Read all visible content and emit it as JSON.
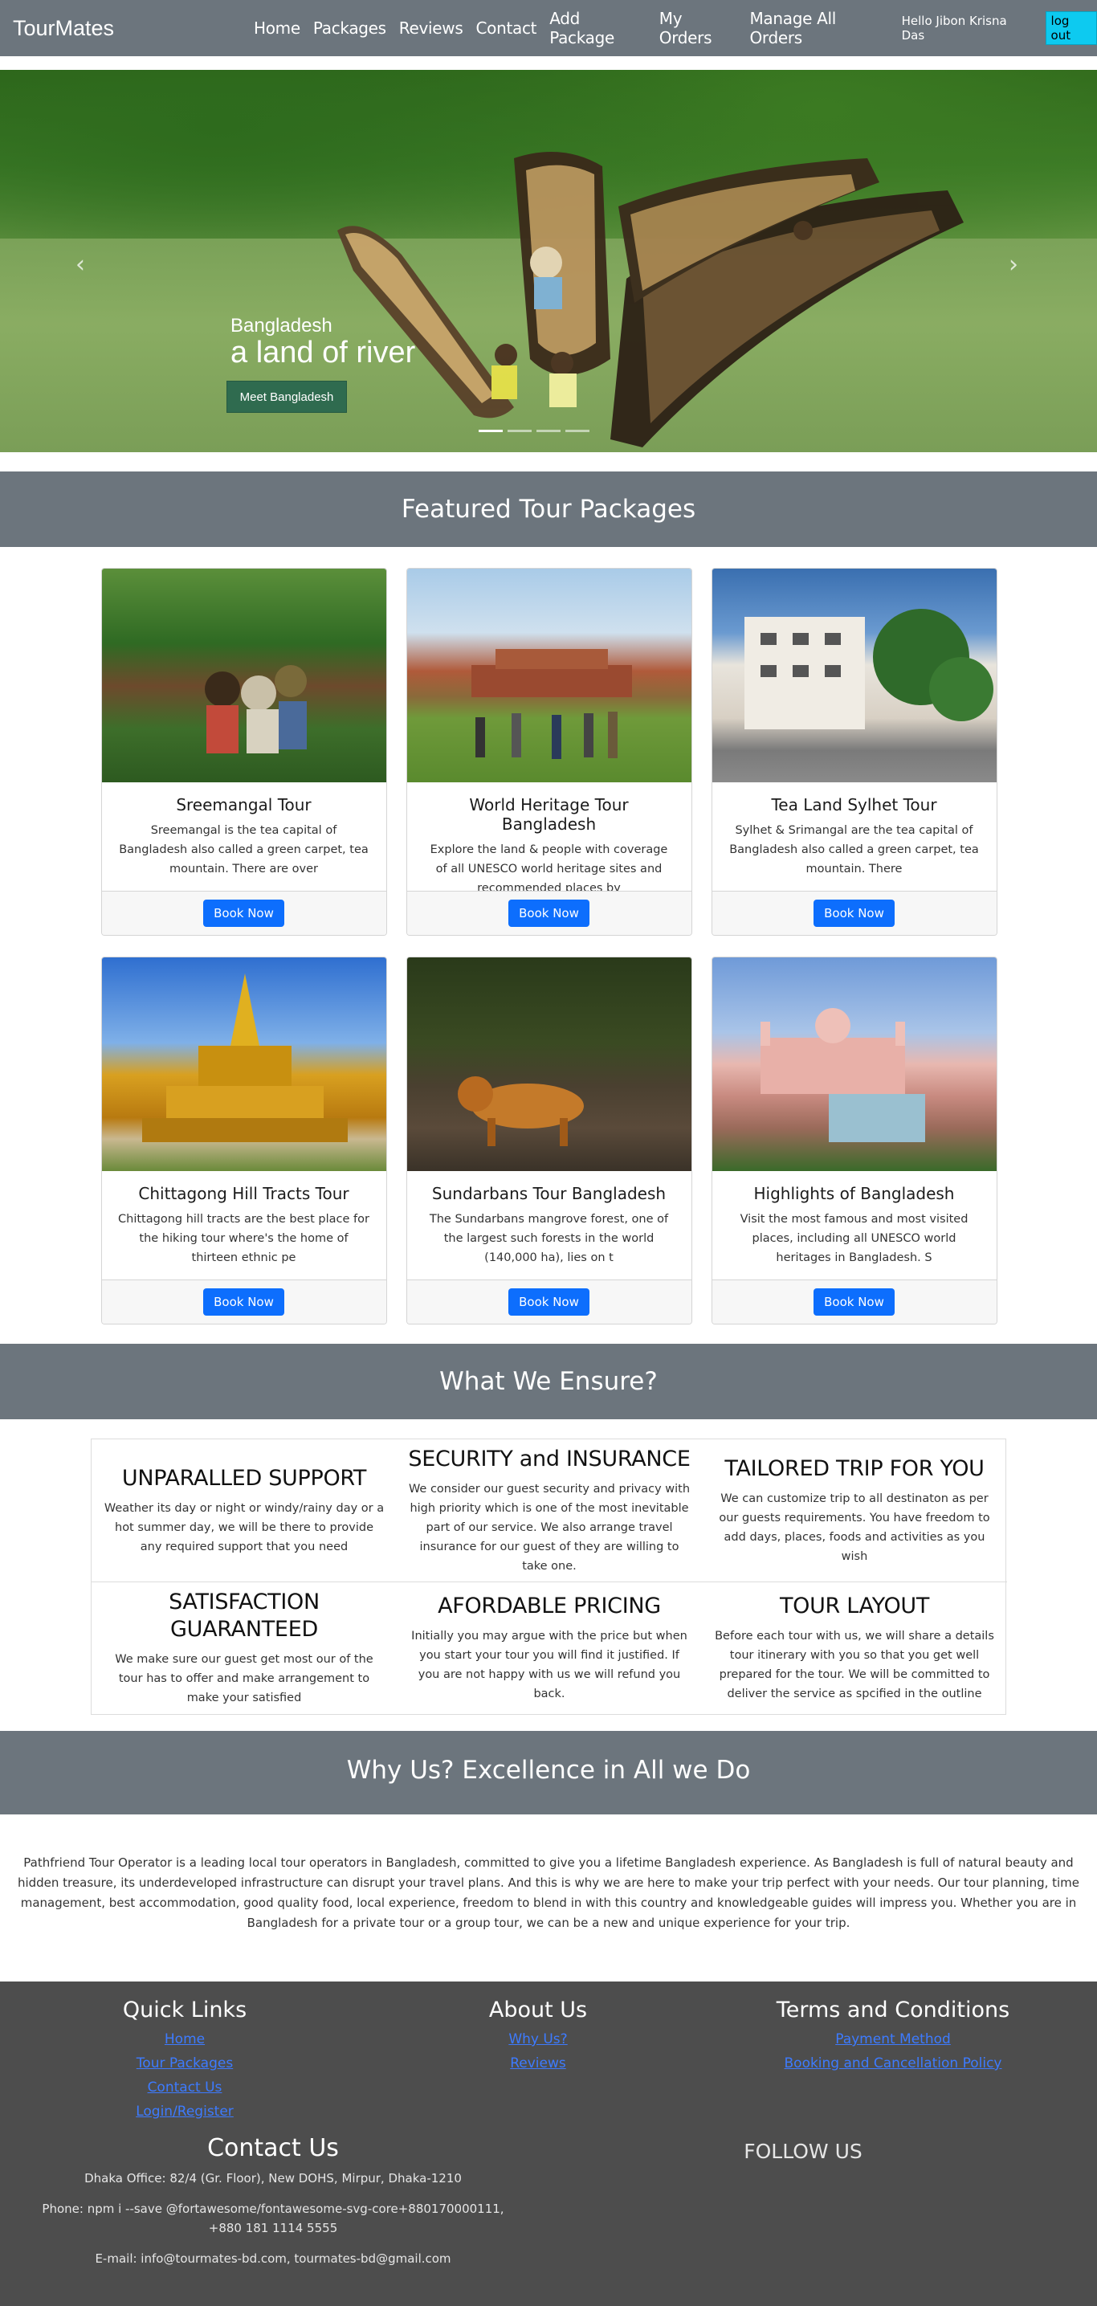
{
  "navbar": {
    "brand": "TourMates",
    "links": [
      "Home",
      "Packages",
      "Reviews",
      "Contact",
      "Add Package",
      "My Orders",
      "Manage All Orders"
    ],
    "greeting": "Hello Jibon Krisna Das",
    "logout_label": "log out"
  },
  "hero": {
    "subtitle": "Bangladesh",
    "title": "a land of river",
    "button_label": "Meet Bangladesh",
    "prev_icon": "chevron-left-icon",
    "next_icon": "chevron-right-icon",
    "slide_count": 4,
    "active_slide": 1
  },
  "featured": {
    "heading": "Featured Tour Packages",
    "book_label": "Book Now",
    "packages": [
      {
        "title": "Sreemangal Tour",
        "text": "Sreemangal is the tea capital of Bangladesh also called a green carpet, tea mountain. There are over"
      },
      {
        "title": "World Heritage Tour Bangladesh",
        "text": "Explore the land & people with coverage of all UNESCO world heritage sites and recommended places by"
      },
      {
        "title": "Tea Land Sylhet Tour",
        "text": "Sylhet & Srimangal are the tea capital of Bangladesh also called a green carpet, tea mountain. There"
      },
      {
        "title": "Chittagong Hill Tracts Tour",
        "text": "Chittagong hill tracts are the best place for the hiking tour where's the home of thirteen ethnic pe"
      },
      {
        "title": "Sundarbans Tour Bangladesh",
        "text": "The Sundarbans mangrove forest, one of the largest such forests in the world (140,000 ha), lies on t"
      },
      {
        "title": "Highlights of Bangladesh",
        "text": "Visit the most famous and most visited places, including all UNESCO world heritages in Bangladesh. S"
      }
    ]
  },
  "ensure": {
    "heading": "What We Ensure?",
    "items": [
      {
        "title": "UNPARALLED SUPPORT",
        "text": "Weather its day or night or windy/rainy day or a hot summer day, we will be there to provide any required support that you need"
      },
      {
        "title": "SECURITY and INSURANCE",
        "text": "We consider our guest security and privacy with high priority which is one of the most inevitable part of our service. We also arrange travel insurance for our guest of they are willing to take one."
      },
      {
        "title": "TAILORED TRIP FOR YOU",
        "text": "We can customize trip to all destinaton as per our guests requirements. You have freedom to add days, places, foods and activities as you wish"
      },
      {
        "title": "SATISFACTION GUARANTEED",
        "text": "We make sure our guest get most our of the tour has to offer and make arrangement to make your satisfied"
      },
      {
        "title": "AFORDABLE PRICING",
        "text": "Initially you may argue with the price but when you start your tour you will find it justified. If you are not happy with us we will refund you back."
      },
      {
        "title": "TOUR LAYOUT",
        "text": "Before each tour with us, we will share a details tour itinerary with you so that you get well prepared for the tour. We will be committed to deliver the service as spcified in the outline"
      }
    ]
  },
  "why": {
    "heading": "Why Us? Excellence in All we Do",
    "text": "Pathfriend Tour Operator is a leading local tour operators in Bangladesh, committed to give you a lifetime Bangladesh experience. As Bangladesh is full of natural beauty and hidden treasure, its underdeveloped infrastructure can disrupt your travel plans. And this is why we are here to make your trip perfect with your needs. Our tour planning, time management, best accommodation, good quality food, local experience, freedom to blend in with this country and knowledgeable guides will impress you. Whether you are in Bangladesh for a private tour or a group tour, we can be a new and unique experience for your trip."
  },
  "footer": {
    "quick_links": {
      "title": "Quick Links",
      "links": [
        "Home",
        "Tour Packages",
        "Contact Us",
        "Login/Register"
      ]
    },
    "about": {
      "title": "About Us",
      "links": [
        "Why Us?",
        "Reviews"
      ]
    },
    "terms": {
      "title": "Terms and Conditions",
      "links": [
        "Payment Method",
        "Booking and Cancellation Policy"
      ]
    },
    "contact": {
      "title": "Contact Us",
      "office": "Dhaka Office: 82/4 (Gr. Floor), New DOHS, Mirpur, Dhaka-1210",
      "phone": "Phone: npm i --save @fortawesome/fontawesome-svg-core+880170000111, +880 181 1114 5555",
      "email": "E-mail: info@tourmates-bd.com, tourmates-bd@gmail.com"
    },
    "follow": "FOLLOW US"
  }
}
